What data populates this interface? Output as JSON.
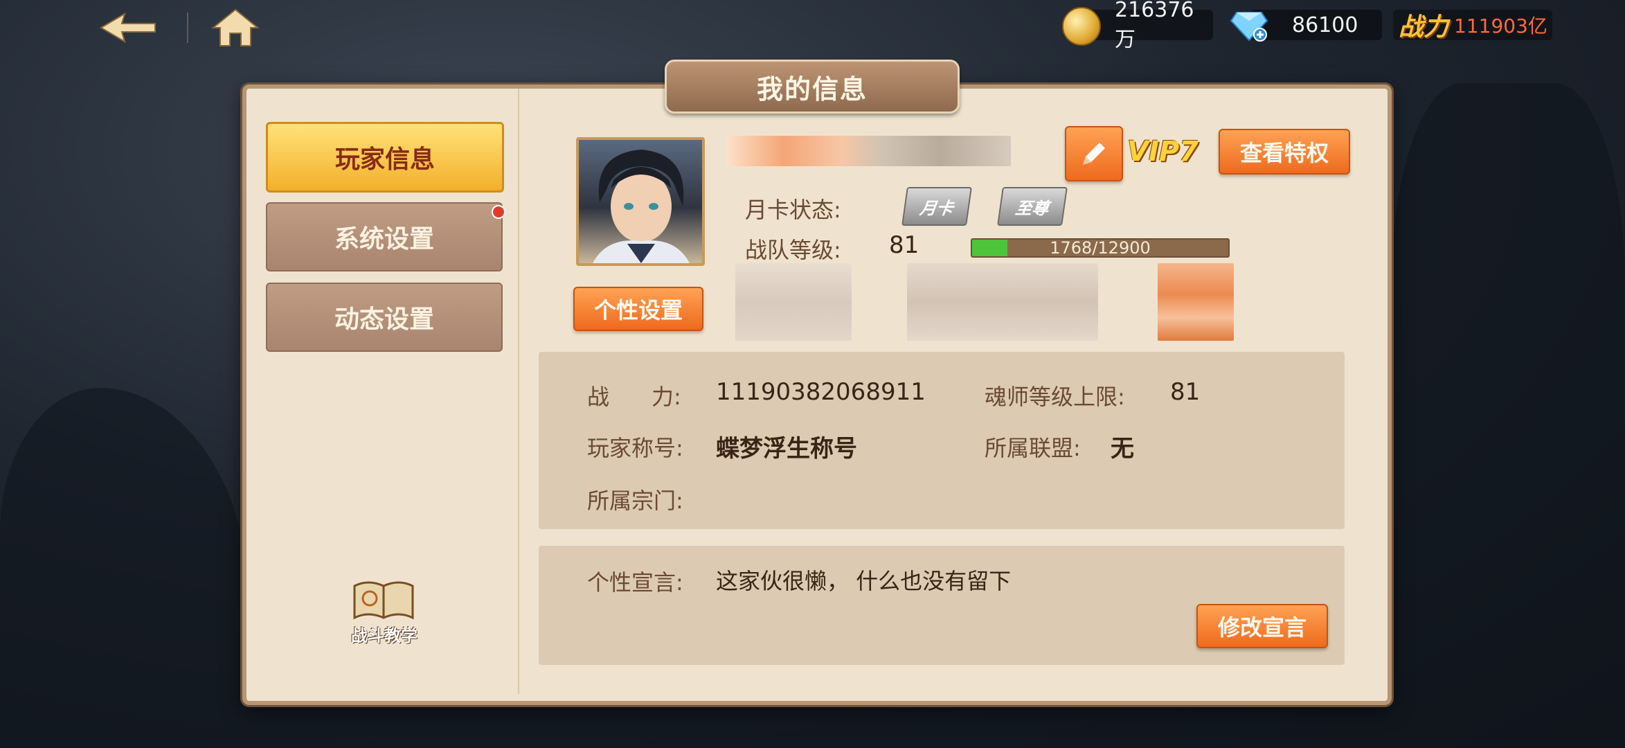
{
  "topbar": {
    "gold_value": "216376万",
    "diamond_value": "86100",
    "power_label": "战力",
    "power_value": "111903亿"
  },
  "panel": {
    "title": "我的信息"
  },
  "sidebar": {
    "items": [
      {
        "label": "玩家信息",
        "active": true
      },
      {
        "label": "系统设置",
        "active": false,
        "has_notification": true
      },
      {
        "label": "动态设置",
        "active": false
      }
    ],
    "tutorial_label": "战斗教学"
  },
  "profile": {
    "vip_label": "VIP7",
    "view_privileges_button": "查看特权",
    "personalize_button": "个性设置",
    "monthly_card_label": "月卡状态:",
    "monthly_card_badges": [
      "月卡",
      "至尊"
    ],
    "team_level_label": "战队等级:",
    "team_level_value": "81",
    "xp_text": "1768/12900",
    "xp_progress": 0.137
  },
  "stats": {
    "power_label": "战      力:",
    "power_value": "11190382068911",
    "soul_limit_label": "魂师等级上限:",
    "soul_limit_value": "81",
    "title_label": "玩家称号:",
    "title_value": "蝶梦浮生称号",
    "alliance_label": "所属联盟:",
    "alliance_value": "无",
    "sect_label": "所属宗门:",
    "sect_value": ""
  },
  "motto": {
    "label": "个性宣言:",
    "text": "这家伙很懒， 什么也没有留下",
    "edit_button": "修改宣言"
  },
  "colors": {
    "panel_bg": "#efe3cf",
    "accent_orange": "#ee6a1e",
    "active_tab": "#f2b02a",
    "xp_green": "#4ec43a"
  }
}
